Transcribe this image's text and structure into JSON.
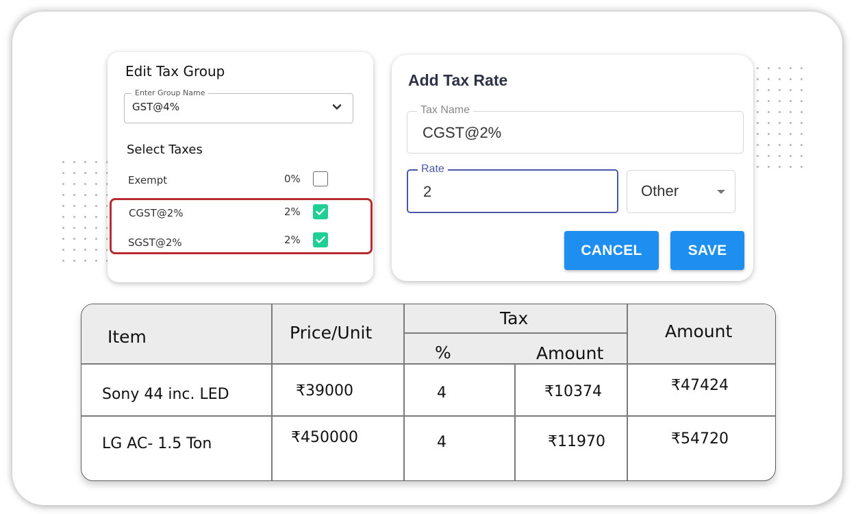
{
  "edit_tax_group": {
    "title": "Edit Tax Group",
    "group_name_label": "Enter Group Name",
    "group_name_value": "GST@4%",
    "select_taxes_title": "Select Taxes",
    "taxes": [
      {
        "name": "Exempt",
        "rate": "0%",
        "checked": false
      },
      {
        "name": "CGST@2%",
        "rate": "2%",
        "checked": true
      },
      {
        "name": "SGST@2%",
        "rate": "2%",
        "checked": true
      }
    ]
  },
  "add_tax_rate": {
    "title": "Add Tax Rate",
    "tax_name_label": "Tax Name",
    "tax_name_value": "CGST@2%",
    "rate_label": "Rate",
    "rate_value": "2",
    "type_value": "Other",
    "cancel_label": "CANCEL",
    "save_label": "SAVE"
  },
  "invoice_table": {
    "headers": {
      "item": "Item",
      "price_unit": "Price/Unit",
      "tax": "Tax",
      "tax_percent": "%",
      "tax_amount": "Amount",
      "amount": "Amount"
    },
    "rows": [
      {
        "item": "Sony 44 inc. LED",
        "price": "₹39000",
        "tax_percent": "4",
        "tax_amount": "₹10374",
        "amount": "₹47424"
      },
      {
        "item": "LG AC- 1.5 Ton",
        "price": "₹450000",
        "tax_percent": "4",
        "tax_amount": "₹11970",
        "amount": "₹54720"
      }
    ]
  },
  "colors": {
    "checkbox_checked": "#1fcf93",
    "highlight_border": "#b52b30",
    "primary_button": "#1e8ff0",
    "focused_field": "#4a57a8"
  }
}
